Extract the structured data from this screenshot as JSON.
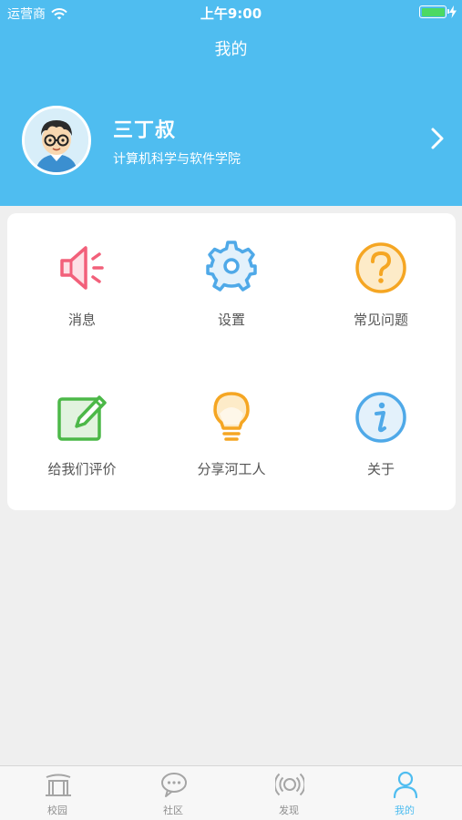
{
  "status_bar": {
    "carrier": "运营商",
    "time": "上午9:00"
  },
  "header": {
    "title": "我的"
  },
  "profile": {
    "name": "三丁叔",
    "school": "计算机科学与软件学院"
  },
  "menu": [
    {
      "label": "消息",
      "icon": "megaphone-icon",
      "color": "#f2607a"
    },
    {
      "label": "设置",
      "icon": "gear-icon",
      "color": "#4fa9e8"
    },
    {
      "label": "常见问题",
      "icon": "question-icon",
      "color": "#f5a623"
    },
    {
      "label": "给我们评价",
      "icon": "edit-note-icon",
      "color": "#4cb848"
    },
    {
      "label": "分享河工人",
      "icon": "lightbulb-icon",
      "color": "#f5a623"
    },
    {
      "label": "关于",
      "icon": "info-icon",
      "color": "#4fa9e8"
    }
  ],
  "tabs": [
    {
      "label": "校园",
      "icon": "campus-gate-icon"
    },
    {
      "label": "社区",
      "icon": "chat-bubble-icon"
    },
    {
      "label": "发现",
      "icon": "broadcast-icon"
    },
    {
      "label": "我的",
      "icon": "person-icon",
      "active": true
    }
  ],
  "colors": {
    "header": "#4fbdf0",
    "active_tab": "#4fbdf0",
    "inactive_tab": "#8e8e8e"
  }
}
